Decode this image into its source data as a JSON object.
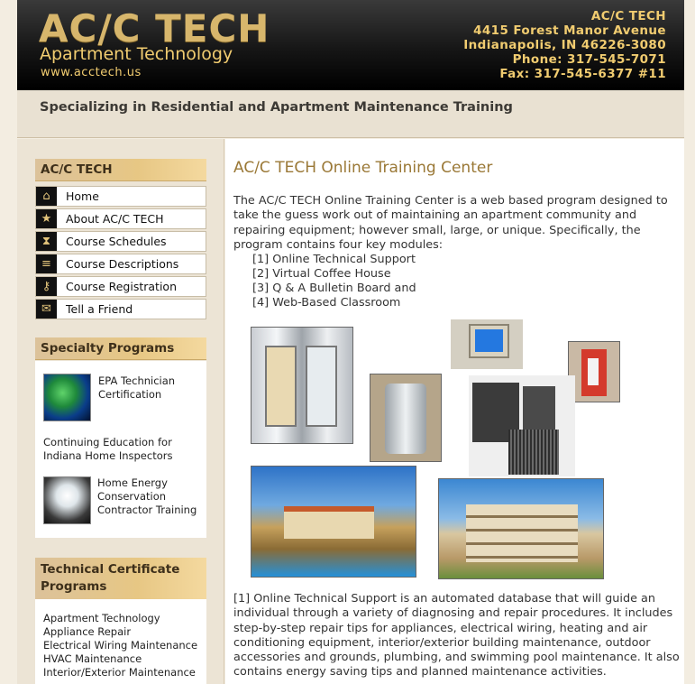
{
  "header": {
    "logo_title": "AC/C TECH",
    "logo_subtitle": "Apartment Technology",
    "logo_url": "www.acctech.us",
    "contact": {
      "company": "AC/C TECH",
      "address": "4415 Forest Manor Avenue",
      "city": "Indianapolis, IN 46226-3080",
      "phone": "Phone: 317-545-7071",
      "fax": "Fax: 317-545-6377 #11"
    }
  },
  "tagline": "Specializing in Residential and Apartment Maintenance Training",
  "sidebar": {
    "nav_title": "AC/C TECH",
    "nav_items": [
      {
        "label": "Home",
        "icon": "home-icon"
      },
      {
        "label": "About AC/C TECH",
        "icon": "star-icon"
      },
      {
        "label": "Course Schedules",
        "icon": "hourglass-icon"
      },
      {
        "label": "Course Descriptions",
        "icon": "document-icon"
      },
      {
        "label": "Course Registration",
        "icon": "key-icon"
      },
      {
        "label": "Tell a Friend",
        "icon": "envelope-icon"
      }
    ],
    "specialty_title": "Specialty Programs",
    "specialty": {
      "epa": "EPA Technician Certification",
      "ce": "Continuing Education for Indiana Home Inspectors",
      "energy": "Home Energy Conservation Contractor Training"
    },
    "tech_title": "Technical Certificate Programs",
    "tech_items": [
      "Apartment Technology",
      "Appliance Repair",
      "Electrical Wiring Maintenance",
      "HVAC Maintenance",
      "Interior/Exterior Maintenance"
    ]
  },
  "main": {
    "title": "AC/C TECH Online Training Center",
    "intro": "The AC/C TECH Online Training Center is a web based program designed to take the guess work out of maintaining an apartment community and repairing equipment; however small, large, or unique. Specifically, the program contains four key modules:",
    "modules": [
      "[1] Online Technical Support",
      "[2] Virtual Coffee House",
      "[3] Q & A Bulletin Board and",
      "[4] Web-Based Classroom"
    ],
    "support_paragraph": "[1] Online Technical Support is an automated database that will guide an individual through a variety of diagnosing and repair procedures. It includes step-by-step repair tips for appliances, electrical wiring, heating and air conditioning equipment, interior/exterior building maintenance, outdoor accessories and grounds, plumbing, and swimming pool maintenance. It also contains energy saving tips and planned maintenance activities."
  },
  "colors": {
    "gold": "#f1cc70",
    "heading_brown": "#9a7836",
    "header_black": "#111111"
  }
}
